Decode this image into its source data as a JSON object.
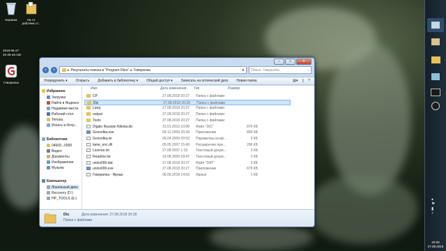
{
  "desktop": {
    "icons": [
      {
        "label": "Корзина"
      },
      {
        "label": "На гл. рабочем ст..."
      },
      {
        "label": "Говорилка"
      }
    ],
    "datetime_lines": [
      "2018-06-27",
      "20-25-46 min"
    ]
  },
  "window": {
    "address": {
      "part1": "Результаты поиска в \"Program Files\"",
      "part2": "Говорилка"
    },
    "search_placeholder": "Поиск: Говорилка",
    "toolbar": [
      "Упорядочить ▾",
      "Открыть",
      "Добавить в библиотеку ▾",
      "Общий доступ ▾",
      "Записать на оптический диск",
      "Новая папка"
    ],
    "nav": {
      "favorites_header": "Избранное",
      "favorites": [
        "Загрузки",
        "Найти в Яндексе",
        "Недавние места",
        "Рабочий стол",
        "Temata",
        "Искать в Интр..."
      ],
      "libraries_header": "Библиотеки",
      "libraries": [
        "04600...0000",
        "Видео",
        "Документы",
        "Изображения",
        "Музыка"
      ],
      "computer_header": "Компьютер",
      "computer": [
        "Локальный диск",
        "Recovery (D:)",
        "HP_TOOLS (E:)"
      ]
    },
    "columns": [
      "Имя",
      "Дата изменения",
      "Тип",
      "Размер"
    ],
    "files": [
      {
        "name": "CP",
        "date": "27.08.2018 20:27",
        "type": "Папка с файлами",
        "size": "",
        "kind": "folder"
      },
      {
        "name": "Dic",
        "date": "27.08.2018 20:28",
        "type": "Папка с файлами",
        "size": "",
        "kind": "folder",
        "selected": true
      },
      {
        "name": "Lang",
        "date": "27.08.2018 20:27",
        "type": "Папка с файлами",
        "size": "",
        "kind": "folder"
      },
      {
        "name": "output",
        "date": "27.08.2018 20:27",
        "type": "Папка с файлами",
        "size": "",
        "kind": "folder"
      },
      {
        "name": "Tools",
        "date": "27.08.2018 20:27",
        "type": "Папка с файлами",
        "size": "",
        "kind": "folder"
      },
      {
        "name": "Digalo Russian Nikolai.dic",
        "date": "31.01.2013 10:08",
        "type": "Файл \"DIC\"",
        "size": "876 КБ",
        "kind": "file"
      },
      {
        "name": "Govorilka.exe",
        "date": "09.12.2009 20:28",
        "type": "Приложение",
        "size": "896 КБ",
        "kind": "exe"
      },
      {
        "name": "Govorilka.ini",
        "date": "06.04.2009 20:53",
        "type": "Параметры конф...",
        "size": "3 КБ",
        "kind": "file"
      },
      {
        "name": "lame_enc.dll",
        "date": "05.05.2007 15:49",
        "type": "Расширение при...",
        "size": "296 КБ",
        "kind": "file"
      },
      {
        "name": "License.txt",
        "date": "27.08.2007 1:10",
        "type": "Текстовый докум...",
        "size": "3 КБ",
        "kind": "file"
      },
      {
        "name": "Readme.txt",
        "date": "19.08.2009 18:47",
        "type": "Текстовый докум...",
        "size": "2 КБ",
        "kind": "file"
      },
      {
        "name": "unins000.dat",
        "date": "27.08.2018 20:27",
        "type": "Файл \"DAT\"",
        "size": "3 КБ",
        "kind": "file"
      },
      {
        "name": "unins000.exe",
        "date": "27.08.2018 20:27",
        "type": "Приложение",
        "size": "679 КБ",
        "kind": "exe"
      },
      {
        "name": "Говорилка - Ярлык",
        "date": "06.06.2018 14:03",
        "type": "Ярлык",
        "size": "1 КБ",
        "kind": "file"
      }
    ],
    "details": {
      "name": "Dic",
      "meta": "Дата изменения: 27.08.2018 20:28",
      "type": "Папка с файлами"
    }
  },
  "taskbar": {
    "clock_lines": [
      "20:29",
      "27.08.2018"
    ]
  },
  "colors": {
    "folder": "#e8c15a",
    "selection": "#cde4fb",
    "accent": "#1f4f9c"
  }
}
